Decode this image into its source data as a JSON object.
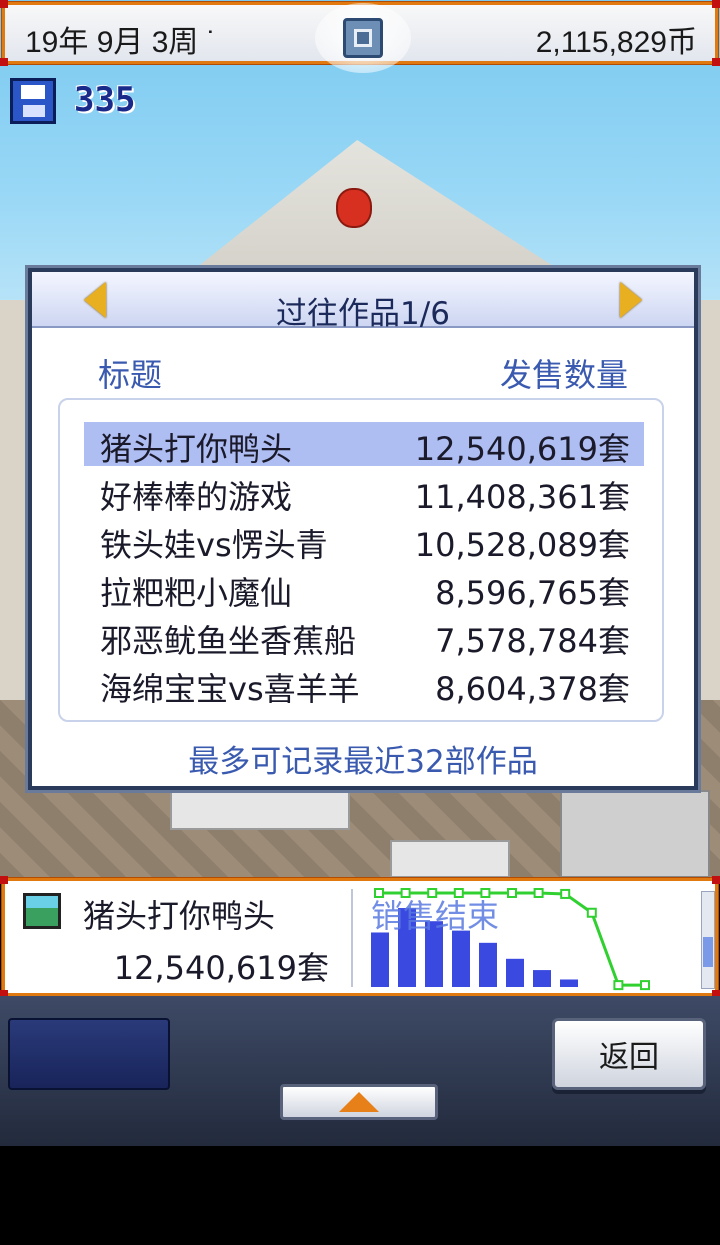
{
  "status_bar": {
    "date": "19年 9月 3周 ˙",
    "money": "2,115,829币"
  },
  "save": {
    "count": "335"
  },
  "dialog": {
    "title": "过往作品1/6",
    "columns": {
      "title": "标题",
      "sales": "发售数量"
    },
    "rows": [
      {
        "name": "猪头打你鸭头",
        "sales": "12,540,619套",
        "selected": true
      },
      {
        "name": "好棒棒的游戏",
        "sales": "11,408,361套",
        "selected": false
      },
      {
        "name": "铁头娃vs愣头青",
        "sales": "10,528,089套",
        "selected": false
      },
      {
        "name": "拉粑粑小魔仙",
        "sales": "8,596,765套",
        "selected": false
      },
      {
        "name": "邪恶鱿鱼坐香蕉船",
        "sales": "7,578,784套",
        "selected": false
      },
      {
        "name": "海绵宝宝vs喜羊羊",
        "sales": "8,604,378套",
        "selected": false
      }
    ],
    "footnote": "最多可记录最近32部作品"
  },
  "info_panel": {
    "name": "猪头打你鸭头",
    "sales": "12,540,619套",
    "status": "销售结束"
  },
  "chart_data": {
    "type": "bar",
    "bars": [
      0.58,
      0.84,
      0.7,
      0.6,
      0.47,
      0.3,
      0.18,
      0.08
    ],
    "line": [
      1.0,
      1.0,
      1.0,
      1.0,
      1.0,
      1.0,
      1.0,
      0.99,
      0.79,
      0.02,
      0.02
    ],
    "colors": {
      "bars": "#3a4ae0",
      "line": "#30d030"
    }
  },
  "menu": {
    "back_label": "返回"
  },
  "colors": {
    "frame_orange": "#e07a10",
    "selection": "#aebdf2",
    "accent_blue": "#3a5ab0"
  }
}
